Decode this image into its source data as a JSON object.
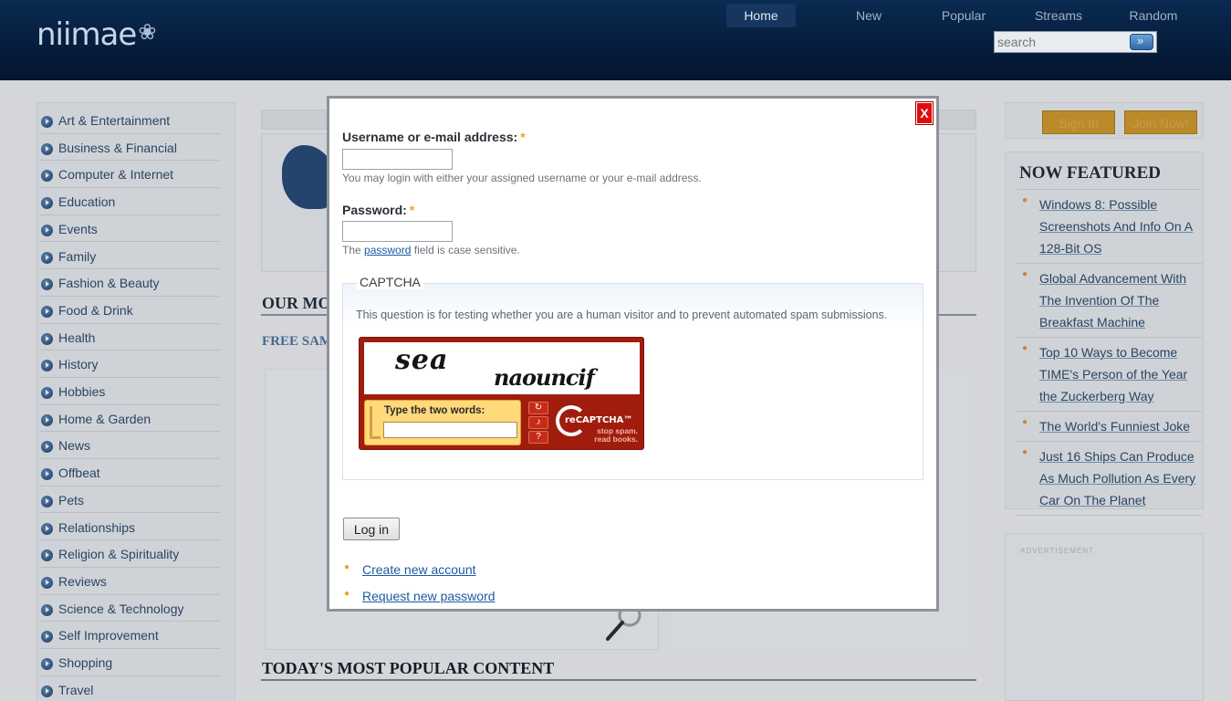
{
  "site": {
    "logo": "niimae",
    "logo_mark": "❀",
    "nav": [
      "Home",
      "New",
      "Popular",
      "Streams",
      "Random"
    ],
    "search_placeholder": "search",
    "search_icon": "search-icon"
  },
  "sidebar": {
    "categories": [
      "Art & Entertainment",
      "Business & Financial",
      "Computer & Internet",
      "Education",
      "Events",
      "Family",
      "Fashion & Beauty",
      "Food & Drink",
      "Health",
      "History",
      "Hobbies",
      "Home & Garden",
      "News",
      "Offbeat",
      "Pets",
      "Relationships",
      "Religion & Spirituality",
      "Reviews",
      "Science & Technology",
      "Self Improvement",
      "Shopping",
      "Travel"
    ]
  },
  "main": {
    "heading_most": "OUR MO",
    "free_samples": "FREE SAM",
    "heading_popular": "TODAY'S MOST POPULAR CONTENT"
  },
  "right": {
    "sign_in": "Sign In",
    "join_now": "Join Now!",
    "featured_title": "NOW FEATURED",
    "featured_items": [
      "Windows 8: Possible Screenshots And Info On A 128-Bit OS",
      "Global Advancement With The Invention Of The Breakfast Machine",
      "Top 10 Ways to Become TIME's Person of the Year the Zuckerberg Way",
      "The World's Funniest Joke",
      "Just 16 Ships Can Produce As Much Pollution As Every Car On The Planet"
    ],
    "advertisement": "ADVERTISEMENT"
  },
  "modal": {
    "close_label": "X",
    "username_label": "Username or e-mail address:",
    "required_mark": "*",
    "username_hint": "You may login with either your assigned username or your e-mail address.",
    "password_label": "Password:",
    "password_hint_pre": "The",
    "password_hint_link": "password",
    "password_hint_post": "field is case sensitive.",
    "captcha_legend": "CAPTCHA",
    "captcha_desc": "This question is for testing whether you are a human visitor and to prevent automated spam submissions.",
    "recaptcha": {
      "word1": "sea",
      "word2": "naouncif",
      "prompt": "Type the two words:",
      "brand": "reCAPTCHA™",
      "tagline_1": "stop spam.",
      "tagline_2": "read books.",
      "tools": [
        "refresh-icon",
        "audio-icon",
        "help-icon"
      ]
    },
    "login_button": "Log in",
    "links": [
      "Create new account",
      "Request new password"
    ]
  },
  "colors": {
    "header_bg": "#061d3c",
    "close_red": "#e10c0c",
    "link_blue": "#1d5aa0",
    "required_orange": "#f0a020",
    "recaptcha_red": "#a01d0e"
  }
}
